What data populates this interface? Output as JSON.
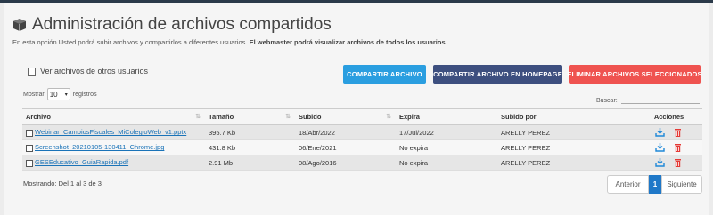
{
  "header": {
    "title": "Administración de archivos compartidos",
    "subtitle_normal": "En esta opción Usted podrá subir archivos y compartirlos a diferentes usuarios.",
    "subtitle_bold": "El webmaster podrá visualizar archivos de todos los usuarios"
  },
  "filters": {
    "other_users_label": "Ver archivos de otros usuarios"
  },
  "buttons": {
    "share": "COMPARTIR ARCHIVO",
    "share_homepage": "COMPARTIR ARCHIVO EN HOMEPAGE",
    "delete_selected": "ELIMINAR ARCHIVOS SELECCIONADOS"
  },
  "colors": {
    "share": "#2a9ee0",
    "share_homepage": "#3d4f7f",
    "delete_selected": "#ef5350",
    "link": "#1a73b8",
    "download_icon": "#1e88d8",
    "delete_icon": "#e53935"
  },
  "length_menu": {
    "prefix": "Mostrar",
    "value": "10",
    "suffix": "registros"
  },
  "search": {
    "label": "Buscar:",
    "value": ""
  },
  "table": {
    "headers": [
      "Archivo",
      "Tamaño",
      "Subido",
      "Expira",
      "Subido por",
      "Acciones"
    ],
    "rows": [
      {
        "file": "Webinar_CambiosFiscales_MiColegioWeb_v1.pptx",
        "size": "395.7 Kb",
        "uploaded": "18/Abr/2022",
        "expires": "17/Jul/2022",
        "by": "ARELLY PEREZ"
      },
      {
        "file": "Screenshot_20210105-130411_Chrome.jpg",
        "size": "431.8 Kb",
        "uploaded": "06/Ene/2021",
        "expires": "No expira",
        "by": "ARELLY PEREZ"
      },
      {
        "file": "GESEducativo_GuiaRapida.pdf",
        "size": "2.91 Mb",
        "uploaded": "08/Ago/2016",
        "expires": "No expira",
        "by": "ARELLY PEREZ"
      }
    ]
  },
  "footer": {
    "info": "Mostrando: Del 1 al 3 de 3",
    "prev": "Anterior",
    "current_page": "1",
    "next": "Siguiente"
  }
}
